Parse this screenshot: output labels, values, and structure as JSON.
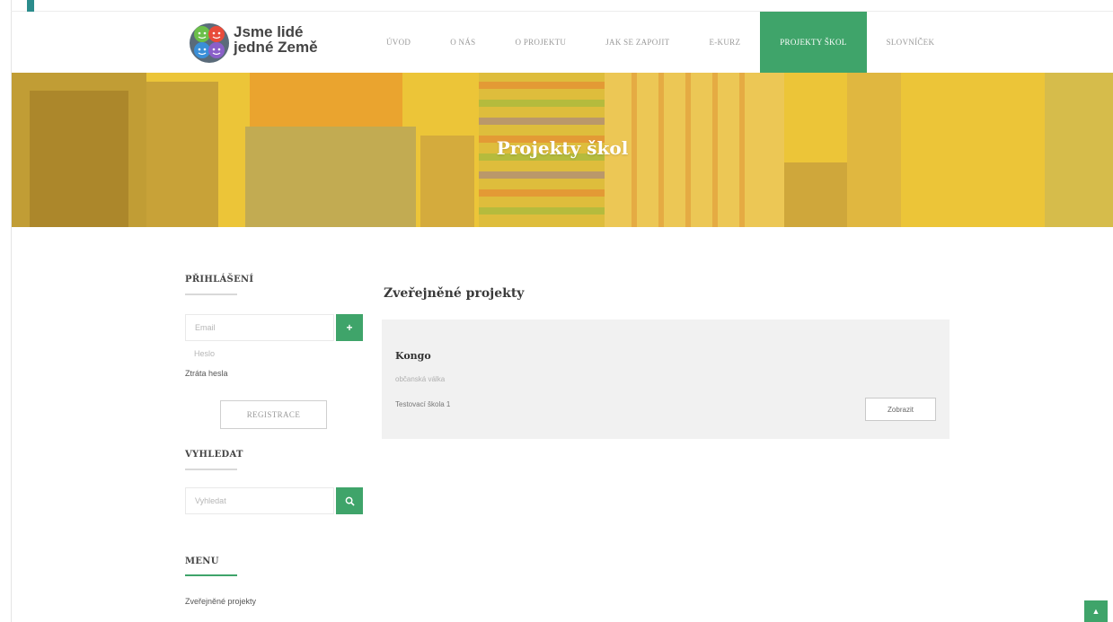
{
  "colors": {
    "accent": "#3fa46a",
    "hero_yellow": "#eec632",
    "marker": "#2b8c8c"
  },
  "header": {
    "logo": {
      "line1": "Jsme lidé",
      "line2": "jedné Země",
      "icon": "four-faces-globe-logo"
    },
    "nav": [
      {
        "label": "ÚVOD",
        "active": false
      },
      {
        "label": "O NÁS",
        "active": false
      },
      {
        "label": "O PROJEKTU",
        "active": false
      },
      {
        "label": "JAK SE ZAPOJIT",
        "active": false
      },
      {
        "label": "E-KURZ",
        "active": false
      },
      {
        "label": "PROJEKTY ŠKOL",
        "active": true
      },
      {
        "label": "SLOVNÍČEK",
        "active": false
      }
    ]
  },
  "hero": {
    "title": "Projekty škol"
  },
  "sidebar": {
    "login": {
      "heading": "PŘIHLÁŠENÍ",
      "email_placeholder": "Email",
      "password_placeholder": "Heslo",
      "submit_icon": "plus-icon",
      "lost_password": "Ztráta hesla",
      "register_label": "REGISTRACE"
    },
    "search": {
      "heading": "VYHLEDAT",
      "placeholder": "Vyhledat",
      "button_icon": "search-icon"
    },
    "menu": {
      "heading": "MENU",
      "items": [
        "Zveřejněné projekty"
      ]
    }
  },
  "main": {
    "title": "Zveřejněné projekty",
    "projects": [
      {
        "title": "Kongo",
        "subtitle": "občanská válka",
        "school": "Testovací škola 1",
        "button": "Zobrazit"
      }
    ]
  },
  "scroll_top": {
    "icon": "chevron-up-icon"
  }
}
